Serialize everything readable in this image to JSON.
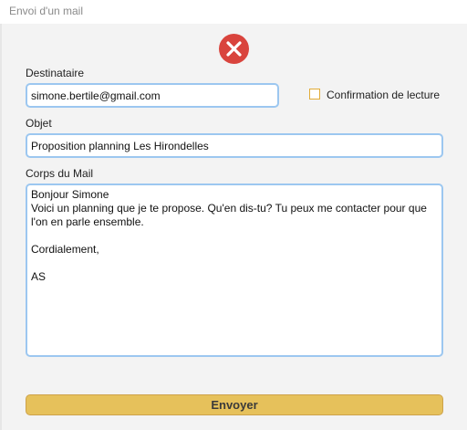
{
  "window": {
    "title": "Envoi d'un mail"
  },
  "form": {
    "recipient_label": "Destinataire",
    "recipient_value": "simone.bertile@gmail.com",
    "read_receipt_label": "Confirmation de lecture",
    "read_receipt_checked": false,
    "subject_label": "Objet",
    "subject_value": "Proposition planning Les Hirondelles",
    "body_label": "Corps du Mail",
    "body_value": "Bonjour Simone\nVoici un planning que je te propose. Qu'en dis-tu? Tu peux me contacter pour que l'on en parle ensemble.\n\nCordialement,\n\nAS",
    "send_label": "Envoyer"
  },
  "icons": {
    "close": "close-icon"
  },
  "colors": {
    "close_red": "#d9443d",
    "send_yellow": "#e6c15b",
    "field_border_blue": "#9cc7f0",
    "checkbox_orange": "#e2ac38"
  }
}
